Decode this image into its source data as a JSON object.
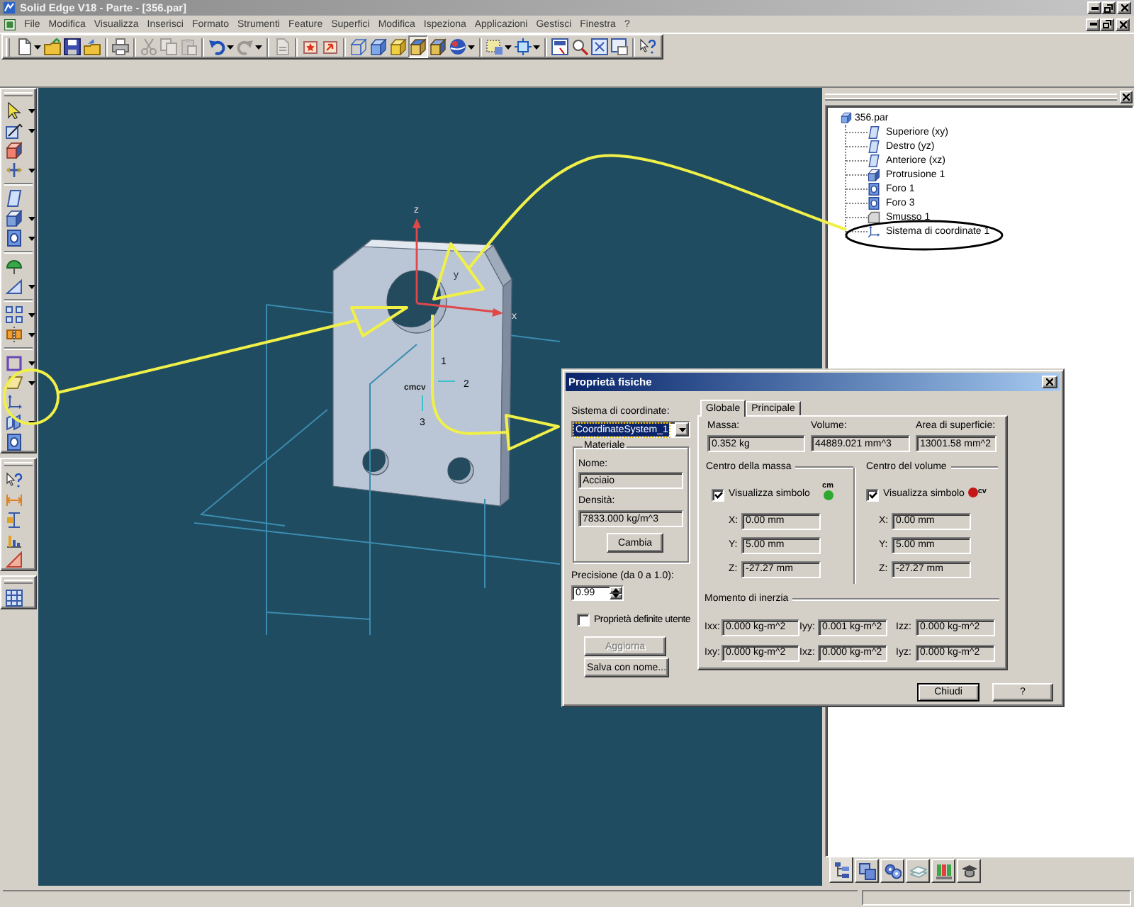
{
  "window": {
    "title": "Solid Edge V18 - Parte - [356.par]"
  },
  "menu_bar": {
    "items": [
      "File",
      "Modifica",
      "Visualizza",
      "Inserisci",
      "Formato",
      "Strumenti",
      "Feature",
      "Superfici",
      "Modifica",
      "Ispeziona",
      "Applicazioni",
      "Gestisci",
      "Finestra",
      "?"
    ]
  },
  "toolbar": {
    "items": [
      {
        "kind": "button",
        "selected": false,
        "disabled": false,
        "dropdown": true
      },
      {
        "kind": "button",
        "selected": false,
        "disabled": false,
        "dropdown": false
      },
      {
        "kind": "button",
        "selected": false,
        "disabled": false,
        "dropdown": false
      },
      {
        "kind": "button",
        "selected": false,
        "disabled": false,
        "dropdown": false
      },
      {
        "kind": "separator"
      },
      {
        "kind": "button",
        "selected": false,
        "disabled": false,
        "dropdown": false
      },
      {
        "kind": "separator"
      },
      {
        "kind": "button",
        "selected": false,
        "disabled": true,
        "dropdown": false
      },
      {
        "kind": "button",
        "selected": false,
        "disabled": true,
        "dropdown": false
      },
      {
        "kind": "button",
        "selected": false,
        "disabled": true,
        "dropdown": false
      },
      {
        "kind": "separator"
      },
      {
        "kind": "button",
        "selected": false,
        "disabled": false,
        "dropdown": true
      },
      {
        "kind": "button",
        "selected": false,
        "disabled": true,
        "dropdown": true
      },
      {
        "kind": "separator"
      },
      {
        "kind": "button",
        "selected": false,
        "disabled": true,
        "dropdown": false
      },
      {
        "kind": "separator"
      },
      {
        "kind": "button",
        "selected": false,
        "disabled": false,
        "dropdown": false
      },
      {
        "kind": "button",
        "selected": false,
        "disabled": false,
        "dropdown": false
      },
      {
        "kind": "separator"
      },
      {
        "kind": "button",
        "selected": false,
        "disabled": false,
        "dropdown": false
      },
      {
        "kind": "button",
        "selected": false,
        "disabled": false,
        "dropdown": false
      },
      {
        "kind": "button",
        "selected": false,
        "disabled": false,
        "dropdown": false
      },
      {
        "kind": "button",
        "selected": true,
        "disabled": false,
        "dropdown": false
      },
      {
        "kind": "button",
        "selected": false,
        "disabled": false,
        "dropdown": false
      },
      {
        "kind": "button",
        "selected": false,
        "disabled": false,
        "dropdown": true
      },
      {
        "kind": "separator"
      },
      {
        "kind": "button",
        "selected": false,
        "disabled": false,
        "dropdown": true
      },
      {
        "kind": "button",
        "selected": false,
        "disabled": false,
        "dropdown": true
      },
      {
        "kind": "separator"
      },
      {
        "kind": "button",
        "selected": false,
        "disabled": false,
        "dropdown": false
      },
      {
        "kind": "button",
        "selected": false,
        "disabled": false,
        "dropdown": false
      },
      {
        "kind": "button",
        "selected": false,
        "disabled": false,
        "dropdown": false
      },
      {
        "kind": "button",
        "selected": false,
        "disabled": false,
        "dropdown": false
      },
      {
        "kind": "separator"
      },
      {
        "kind": "button",
        "selected": false,
        "disabled": false,
        "dropdown": false
      }
    ]
  },
  "feature_toolbars": [
    {
      "items": [
        {
          "kind": "button",
          "dropdown": true
        },
        {
          "kind": "button",
          "dropdown": true
        },
        {
          "kind": "button",
          "dropdown": false
        },
        {
          "kind": "button",
          "dropdown": true
        },
        {
          "kind": "separator"
        },
        {
          "kind": "button",
          "dropdown": false
        },
        {
          "kind": "button",
          "dropdown": true
        },
        {
          "kind": "button",
          "dropdown": true
        },
        {
          "kind": "separator"
        },
        {
          "kind": "button",
          "dropdown": false
        },
        {
          "kind": "button",
          "dropdown": true
        },
        {
          "kind": "separator"
        },
        {
          "kind": "button",
          "dropdown": true
        },
        {
          "kind": "button",
          "dropdown": true
        },
        {
          "kind": "separator"
        },
        {
          "kind": "button",
          "dropdown": true
        },
        {
          "kind": "button",
          "dropdown": true
        },
        {
          "kind": "button",
          "dropdown": false
        },
        {
          "kind": "button",
          "dropdown": true
        },
        {
          "kind": "button",
          "dropdown": false
        }
      ]
    },
    {
      "items": [
        {
          "kind": "button",
          "dropdown": false
        },
        {
          "kind": "button",
          "dropdown": false
        },
        {
          "kind": "button",
          "dropdown": false
        },
        {
          "kind": "button",
          "dropdown": false
        },
        {
          "kind": "button",
          "dropdown": false
        }
      ]
    },
    {
      "items": [
        {
          "kind": "button",
          "dropdown": false
        }
      ]
    }
  ],
  "viewport": {
    "axis_labels": [
      "z",
      "y",
      "x"
    ],
    "feature_labels": [
      "1",
      "2",
      "3"
    ],
    "symbol_label": "cmcv"
  },
  "feature_tree": {
    "items": [
      {
        "label": "356.par",
        "kind": "part",
        "children": [
          {
            "label": "Superiore (xy)",
            "kind": "plane"
          },
          {
            "label": "Destro (yz)",
            "kind": "plane"
          },
          {
            "label": "Anteriore (xz)",
            "kind": "plane"
          },
          {
            "label": "Protrusione 1",
            "kind": "protrusion"
          },
          {
            "label": "Foro 1",
            "kind": "hole"
          },
          {
            "label": "Foro 3",
            "kind": "hole"
          },
          {
            "label": "Smusso 1",
            "kind": "chamfer"
          },
          {
            "label": "Sistema di coordinate 1",
            "kind": "coordinate_system"
          }
        ]
      }
    ]
  },
  "panel_tabs": [
    {
      "selected": true
    },
    {
      "selected": false
    },
    {
      "selected": false
    },
    {
      "selected": false
    },
    {
      "selected": false
    },
    {
      "selected": false
    }
  ],
  "dialog": {
    "title": "Proprietà fisiche",
    "coordinate_system": {
      "label": "Sistema di coordinate:",
      "value": "CoordinateSystem_1",
      "focused": true
    },
    "material": {
      "title": "Materiale",
      "name_label": "Nome:",
      "name": "Acciaio",
      "density_label": "Densità:",
      "density": "7833.000 kg/m^3",
      "change_button": "Cambia"
    },
    "precision": {
      "label": "Precisione (da 0 a 1.0):",
      "value": "0.99"
    },
    "user_defined": {
      "label": "Proprietà definite utente",
      "checked": false
    },
    "side_buttons": [
      {
        "label": "Aggiorna",
        "disabled": true
      },
      {
        "label": "Salva con nome...",
        "disabled": false
      }
    ],
    "tabs": [
      {
        "label": "Globale",
        "selected": true
      },
      {
        "label": "Principale",
        "selected": false
      }
    ],
    "globals": [
      {
        "label": "Massa:",
        "value": "0.352 kg"
      },
      {
        "label": "Volume:",
        "value": "44889.021 mm^3"
      },
      {
        "label": "Area di superficie:",
        "value": "13001.58 mm^2"
      }
    ],
    "centers": [
      {
        "title": "Centro della massa",
        "show_symbol": {
          "label": "Visualizza simbolo",
          "checked": true
        },
        "symbol": "cm",
        "color": "#2fa82f",
        "coordinates": [
          {
            "label": "X:",
            "value": "0.00 mm"
          },
          {
            "label": "Y:",
            "value": "5.00 mm"
          },
          {
            "label": "Z:",
            "value": "-27.27 mm"
          }
        ]
      },
      {
        "title": "Centro del volume",
        "show_symbol": {
          "label": "Visualizza simbolo",
          "checked": true
        },
        "symbol": "cv",
        "color": "#c41818",
        "coordinates": [
          {
            "label": "X:",
            "value": "0.00 mm"
          },
          {
            "label": "Y:",
            "value": "5.00 mm"
          },
          {
            "label": "Z:",
            "value": "-27.27 mm"
          }
        ]
      }
    ],
    "inertia": {
      "title": "Momento di inerzia",
      "values": [
        {
          "label": "Ixx:",
          "value": "0.000 kg-m^2"
        },
        {
          "label": "Iyy:",
          "value": "0.001 kg-m^2"
        },
        {
          "label": "Izz:",
          "value": "0.000 kg-m^2"
        },
        {
          "label": "Ixy:",
          "value": "0.000 kg-m^2"
        },
        {
          "label": "Ixz:",
          "value": "0.000 kg-m^2"
        },
        {
          "label": "Iyz:",
          "value": "0.000 kg-m^2"
        }
      ]
    },
    "buttons": [
      {
        "label": "Chiudi",
        "default": true
      },
      {
        "label": "?",
        "default": false
      }
    ]
  }
}
